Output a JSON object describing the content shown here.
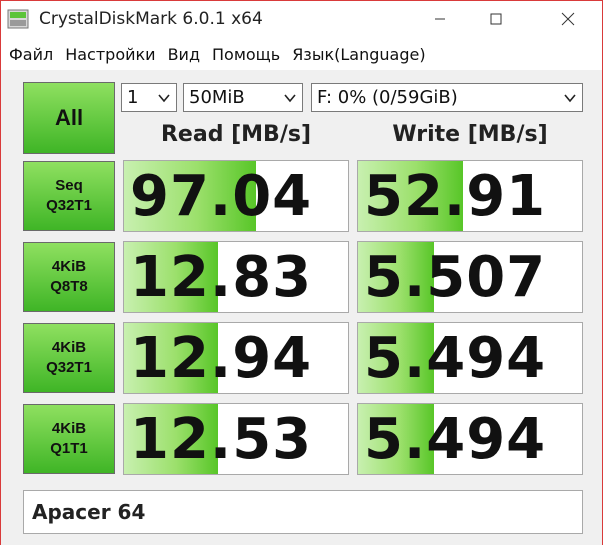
{
  "window": {
    "title": "CrystalDiskMark 6.0.1 x64",
    "icon": "crystaldiskmark-app-icon",
    "controls": [
      "minimize-icon",
      "maximize-icon",
      "close-icon"
    ]
  },
  "menu": {
    "items": [
      {
        "label": "Файл"
      },
      {
        "label": "Настройки"
      },
      {
        "label": "Вид"
      },
      {
        "label": "Помощь"
      },
      {
        "label": "Язык(Language)"
      }
    ]
  },
  "controls": {
    "all_label": "All",
    "count_value": "1",
    "size_value": "50MiB",
    "drive_value": "F: 0% (0/59GiB)"
  },
  "headers": {
    "read": "Read [MB/s]",
    "write": "Write [MB/s]"
  },
  "tests": [
    {
      "line1": "Seq",
      "line2": "Q32T1",
      "read": "97.04",
      "write": "52.91",
      "read_fill": 0.59,
      "write_fill": 0.47
    },
    {
      "line1": "4KiB",
      "line2": "Q8T8",
      "read": "12.83",
      "write": "5.507",
      "read_fill": 0.42,
      "write_fill": 0.34
    },
    {
      "line1": "4KiB",
      "line2": "Q32T1",
      "read": "12.94",
      "write": "5.494",
      "read_fill": 0.42,
      "write_fill": 0.34
    },
    {
      "line1": "4KiB",
      "line2": "Q1T1",
      "read": "12.53",
      "write": "5.494",
      "read_fill": 0.42,
      "write_fill": 0.34
    }
  ],
  "comment": "Apacer 64",
  "colors": {
    "button_green_top": "#8fe060",
    "button_green_bottom": "#3fb526",
    "window_border": "#d93a3a"
  }
}
